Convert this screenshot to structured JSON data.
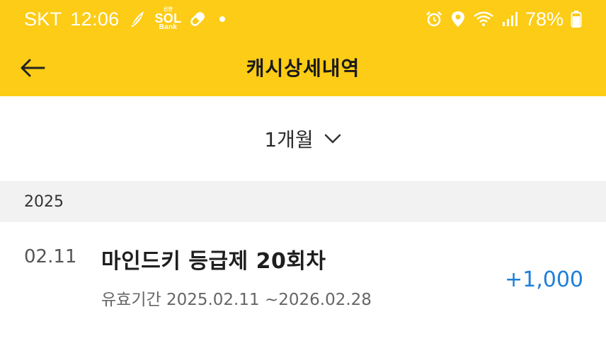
{
  "status_bar": {
    "carrier": "SKT",
    "time": "12:06",
    "sol_top": "신한",
    "sol_main": "SOL",
    "sol_bottom": "Bank",
    "battery": "78%"
  },
  "header": {
    "title": "캐시상세내역"
  },
  "filter": {
    "period": "1개월"
  },
  "sections": [
    {
      "year": "2025",
      "items": [
        {
          "date": "02.11",
          "title": "마인드키 등급제 20회차",
          "validity": "유효기간 2025.02.11 ~2026.02.28",
          "amount": "+1,000"
        }
      ]
    }
  ],
  "colors": {
    "brand_yellow": "#fccc16",
    "amount_blue": "#1e7fd9",
    "section_bg": "#f2f2f2"
  }
}
